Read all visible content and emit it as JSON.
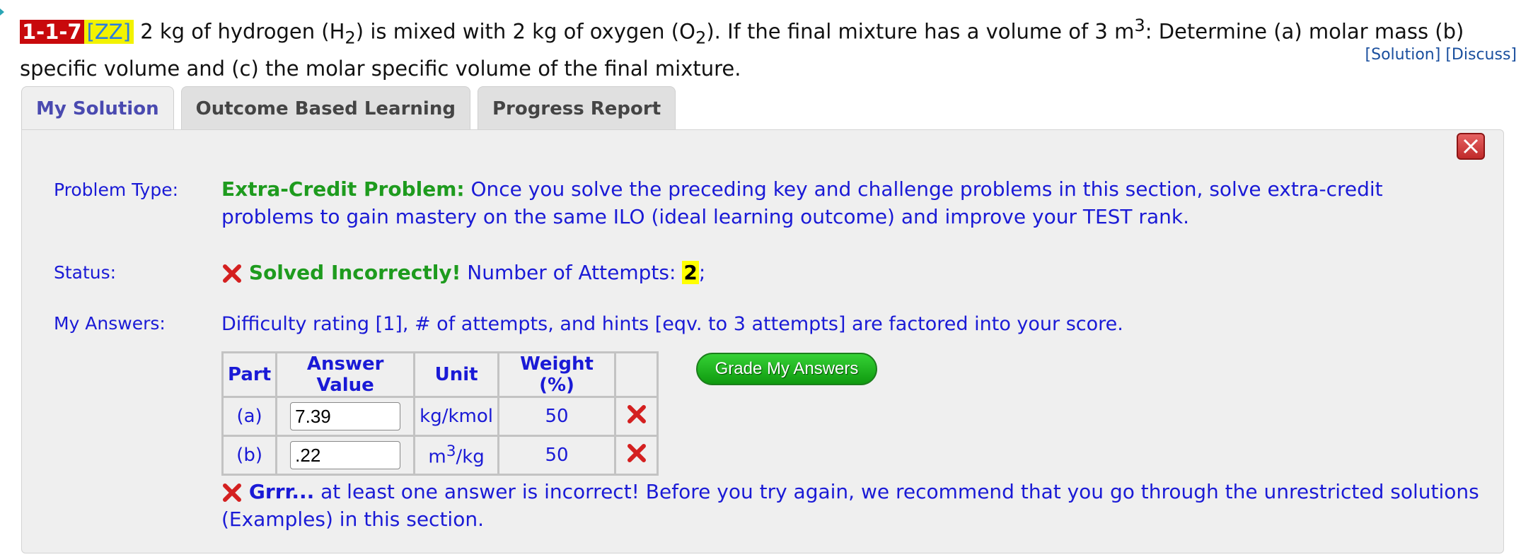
{
  "problem": {
    "id": "1-1-7",
    "tag": "[ZZ]",
    "text_before_h2": "2 kg of hydrogen (H",
    "sub_h2": "2",
    "text_between": ") is mixed with 2 kg of oxygen (O",
    "sub_o2": "2",
    "text_after_o2": "). If the final mixture has a volume of 3 m",
    "sup_m3": "3",
    "text_end": ": Determine (a) molar mass (b) specific volume and (c) the molar specific volume of the final mixture.",
    "solution_link": "[Solution]",
    "discuss_link": "[Discuss]"
  },
  "tabs": [
    {
      "label": "My Solution",
      "active": true
    },
    {
      "label": "Outcome Based Learning",
      "active": false
    },
    {
      "label": "Progress Report",
      "active": false
    }
  ],
  "panel": {
    "problem_type_label": "Problem Type:",
    "problem_type_bold": "Extra-Credit Problem:",
    "problem_type_text": "Once you solve the preceding key and challenge problems in this section, solve extra-credit problems to gain mastery on the same ILO (ideal learning outcome) and improve your TEST rank.",
    "status_label": "Status:",
    "status_bold": "Solved Incorrectly!",
    "attempts_text": "Number of Attempts:",
    "attempts_count": "2",
    "attempts_suffix": ";",
    "answers_label": "My Answers:",
    "answers_note": "Difficulty rating [1], # of attempts, and hints [eqv. to 3 attempts] are factored into your score.",
    "grade_button": "Grade My Answers",
    "feedback_bold": "Grrr...",
    "feedback_text": "at least one answer is incorrect! Before you try again, we recommend that you go through the unrestricted solutions (Examples) in this section."
  },
  "table": {
    "headers": [
      "Part",
      "Answer Value",
      "Unit",
      "Weight (%)",
      ""
    ],
    "rows": [
      {
        "part": "(a)",
        "value": "7.39",
        "unit": "kg/kmol",
        "weight": "50"
      },
      {
        "part": "(b)",
        "value": ".22",
        "unit": "m",
        "unit_sup": "3",
        "unit_suffix": "/kg",
        "weight": "50"
      }
    ]
  },
  "colors": {
    "id_badge": "#c8090c",
    "tag_bg": "#f2f200",
    "link_blue": "#1a1ad6",
    "success_green": "#1e9b1e",
    "error_red": "#d42020"
  }
}
